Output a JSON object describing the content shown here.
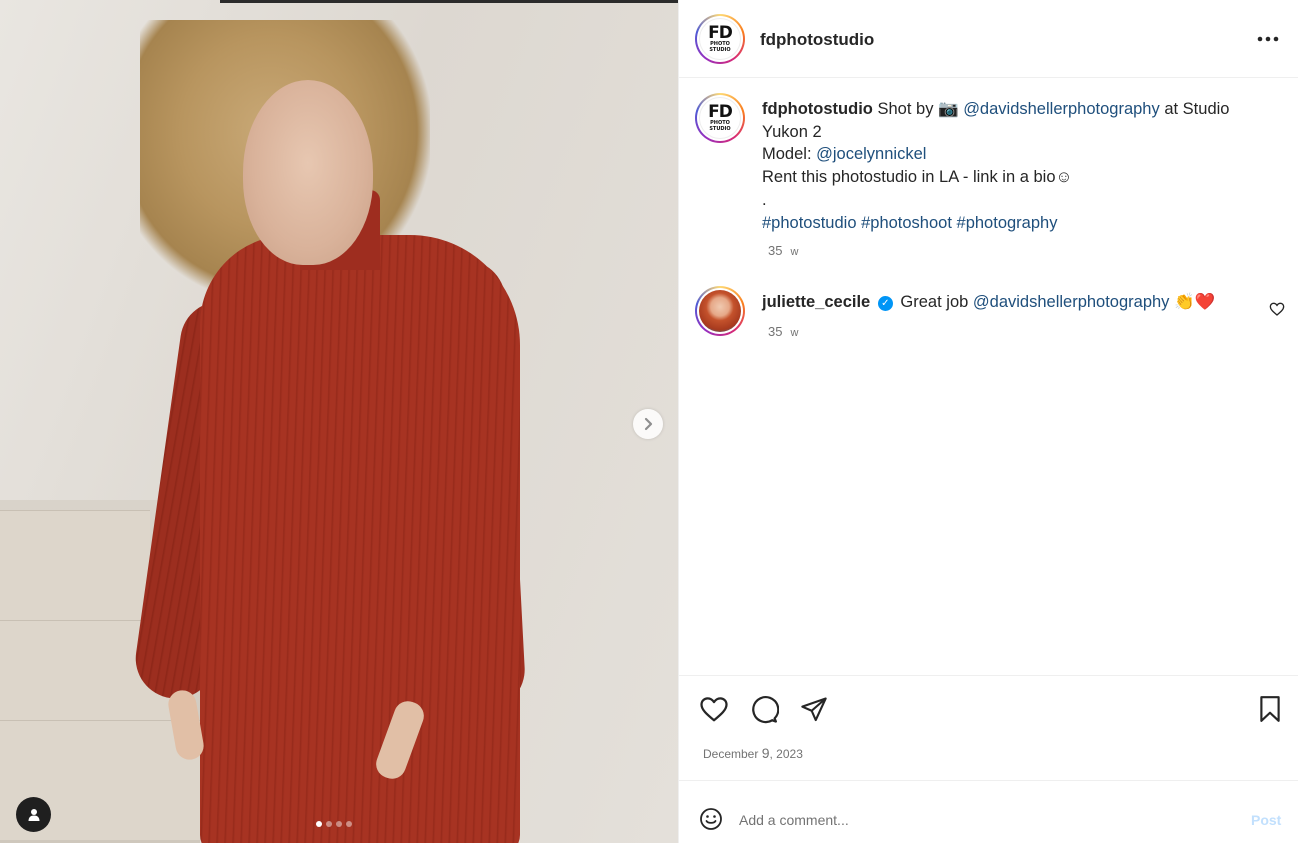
{
  "post": {
    "author": "fdphotostudio",
    "logo": {
      "mark": "FD",
      "sub1": "PHOTO",
      "sub2": "STUDIO"
    },
    "more_icon": "more-horizontal-icon"
  },
  "media": {
    "slide_count": 4,
    "active_slide": 1,
    "next_icon": "chevron-right-icon",
    "tag_icon": "person-icon"
  },
  "caption": {
    "username": "fdphotostudio",
    "text_shot_by": "Shot by",
    "camera_emoji": "📷",
    "mention_photographer": "@davidshellerphotography",
    "text_at_studio": "at Studio Yukon 2",
    "model_label": "Model:",
    "mention_model": "@jocelynnickel",
    "line_rent": "Rent this photostudio in LA - link in a bio☺",
    "line_dot": ".",
    "hashtags": [
      "#photostudio",
      "#photoshoot",
      "#photography"
    ],
    "age": "35",
    "age_unit": "w"
  },
  "comment": {
    "username": "juliette_cecile",
    "verified_icon": "verified-badge-icon",
    "text": "Great job",
    "mention": "@davidshellerphotography",
    "emojis": "👏❤️",
    "age": "35",
    "age_unit": "w",
    "like_icon": "heart-outline-icon"
  },
  "actions": {
    "like_icon": "heart-icon",
    "comment_icon": "comment-icon",
    "share_icon": "send-icon",
    "save_icon": "bookmark-icon",
    "date_month": "December",
    "date_day": "9",
    "date_year": ", 2023"
  },
  "add_comment": {
    "emoji_icon": "smiley-icon",
    "placeholder": "Add a comment...",
    "post_label": "Post"
  },
  "colors": {
    "link": "#1f4f7c",
    "muted": "#737373",
    "post_disabled": "#c2e0fd",
    "verified": "#0095f6",
    "dress": "#a73322"
  }
}
